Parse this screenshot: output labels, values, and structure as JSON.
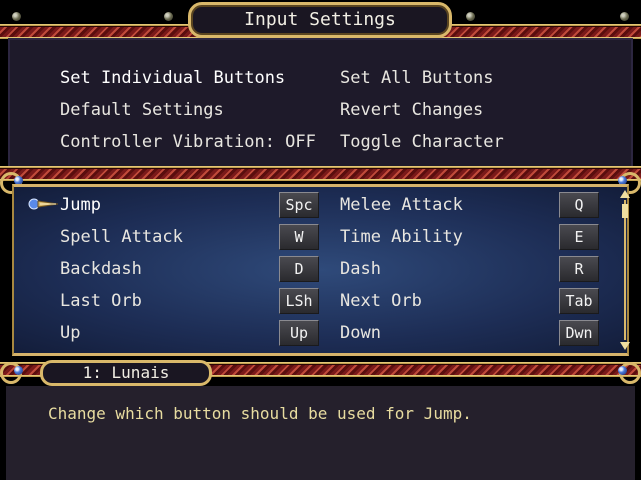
{
  "title": "Input Settings",
  "options": {
    "set_individual": "Set Individual Buttons",
    "set_all": "Set All Buttons",
    "default_settings": "Default Settings",
    "revert_changes": "Revert Changes",
    "controller_vibration": "Controller Vibration: OFF",
    "toggle_character": "Toggle Character"
  },
  "bindings": [
    {
      "action": "Jump",
      "key": "Spc"
    },
    {
      "action": "Spell Attack",
      "key": "W"
    },
    {
      "action": "Backdash",
      "key": "D"
    },
    {
      "action": "Last Orb",
      "key": "LSh"
    },
    {
      "action": "Up",
      "key": "Up"
    },
    {
      "action": "Melee Attack",
      "key": "Q"
    },
    {
      "action": "Time Ability",
      "key": "E"
    },
    {
      "action": "Dash",
      "key": "R"
    },
    {
      "action": "Next Orb",
      "key": "Tab"
    },
    {
      "action": "Down",
      "key": "Dwn"
    }
  ],
  "character": "1: Lunais",
  "help_text": "Change which button should be used for Jump.",
  "scrollbar": {
    "up_icon": "triangle-up",
    "down_icon": "triangle-down"
  }
}
